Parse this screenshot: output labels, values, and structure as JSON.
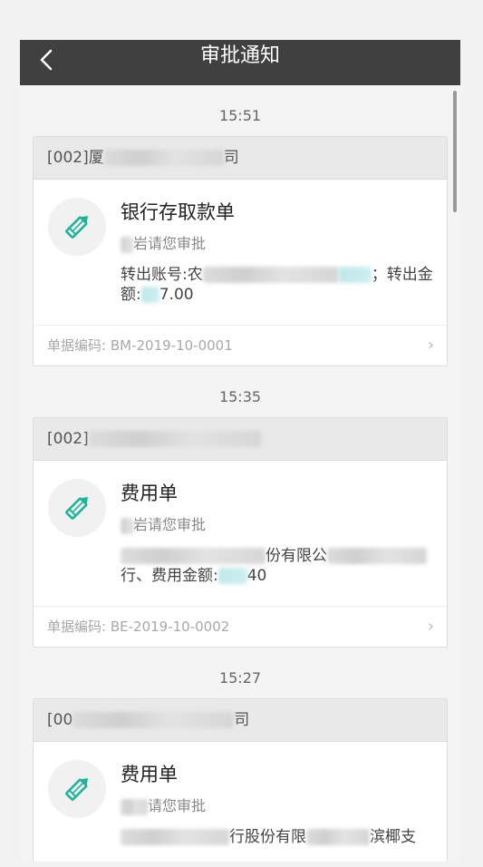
{
  "header": {
    "title": "审批通知"
  },
  "notifications": [
    {
      "time": "15:51",
      "company_prefix": "[002]厦",
      "company_suffix": "司",
      "title": "银行存取款单",
      "subtitle_suffix": "岩请您审批",
      "desc_line1_a": "转出账号:农",
      "desc_line1_b": "；转出金",
      "desc_line2_a": "额:",
      "desc_line2_b": "7.00",
      "code_label": "单据编码:",
      "code_value": "BM-2019-10-0001"
    },
    {
      "time": "15:35",
      "company_prefix": "[002]",
      "company_suffix": "",
      "title": "费用单",
      "subtitle_suffix": "岩请您审批",
      "desc_line1_a": "",
      "desc_line1_b": "份有限公",
      "desc_line2_a": "行、费用金额:",
      "desc_line2_b": "40",
      "code_label": "单据编码:",
      "code_value": "BE-2019-10-0002"
    },
    {
      "time": "15:27",
      "company_prefix": "[00",
      "company_suffix": "司",
      "title": "费用单",
      "subtitle_suffix": "请您审批",
      "desc_line1_a": "",
      "desc_line1_b": "行股份有限",
      "desc_line2_a": "",
      "desc_line2_b": "",
      "code_label": "",
      "code_value": "",
      "extra_tail": "滨椰支"
    }
  ],
  "colors": {
    "header_bg": "#404040",
    "icon_accent": "#1fb39a"
  },
  "icons": {
    "back": "chevron-left-icon",
    "document": "pencil-icon",
    "more": "chevron-right-icon"
  }
}
